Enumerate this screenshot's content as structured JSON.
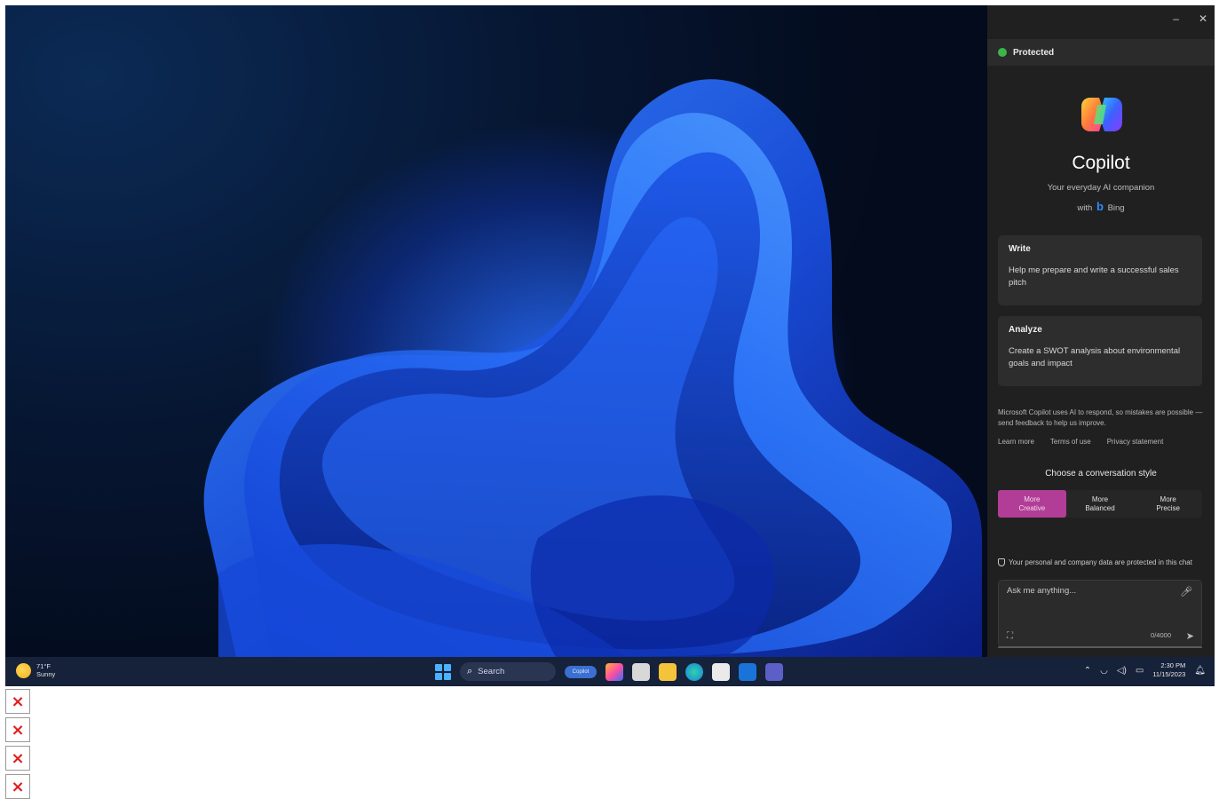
{
  "copilot": {
    "window_controls": {
      "minimize": "–",
      "close": "✕"
    },
    "status": "Protected",
    "title": "Copilot",
    "subtitle": "Your everyday AI companion",
    "with_prefix": "with",
    "bing_label": "Bing",
    "cards": [
      {
        "title": "Write",
        "body": "Help me prepare and write a successful sales pitch"
      },
      {
        "title": "Analyze",
        "body": "Create a SWOT analysis about environmental goals and impact"
      }
    ],
    "disclaimer": "Microsoft Copilot uses AI to respond, so mistakes are possible — send feedback to help us improve.",
    "links": [
      "Learn more",
      "Terms of use",
      "Privacy statement"
    ],
    "style_title": "Choose a conversation style",
    "styles": [
      {
        "line1": "More",
        "line2": "Creative",
        "active": true
      },
      {
        "line1": "More",
        "line2": "Balanced",
        "active": false
      },
      {
        "line1": "More",
        "line2": "Precise",
        "active": false
      }
    ],
    "privacy_note": "Your personal and company data are protected in this chat",
    "chat_placeholder": "Ask me anything...",
    "char_count": "0/4000"
  },
  "taskbar": {
    "weather_temp": "71°F",
    "weather_desc": "Sunny",
    "search_label": "Search",
    "copilot_pill": "Copilot",
    "time": "2:30 PM",
    "date": "11/15/2023"
  },
  "colors": {
    "accent_creative": "#b13d97",
    "protected_green": "#3bb54a",
    "panel_bg": "#202020",
    "taskbar_bg": "#16213a"
  },
  "icons": [
    "copilot-logo-icon",
    "bing-icon",
    "mic-icon",
    "send-icon",
    "windows-start-icon",
    "search-icon",
    "file-explorer-icon",
    "edge-icon",
    "store-icon",
    "outlook-icon",
    "teams-icon",
    "wifi-icon",
    "volume-icon",
    "battery-icon",
    "notification-bell-icon",
    "broken-image-icon"
  ]
}
